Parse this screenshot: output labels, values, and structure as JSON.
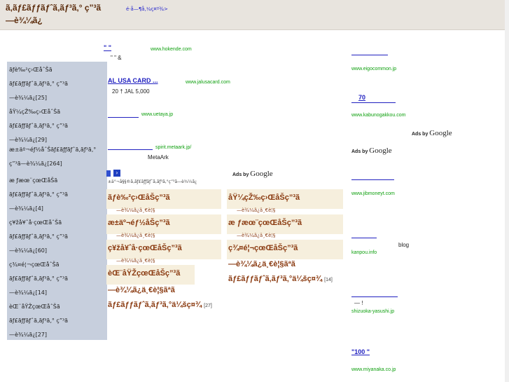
{
  "header": {
    "title_line1": "ã‚ãƒ£ãƒƒãƒˆã‚ãƒ³ã‚° ç”³ã",
    "title_line2": "—è¾¼ã¿",
    "tagline": "é·å—¶å‚¼ç¤º¾>"
  },
  "sidebar": {
    "items": [
      {
        "line1": "ãƒè‰²ç›ŒåˆŠã",
        "line2": "ãƒ£ãƒƒãƒˆã‚ãƒ³ã‚° ç”³ã",
        "line3": "—è¾¼ã¿[25]"
      },
      {
        "line1": "åŸ¼çŽ‰ç›ŒåˆŠã",
        "line2": "ãƒ£ãƒƒãƒˆã‚ãƒ³ã‚° ç”³ã",
        "line3": "—è¾¼ã¿[29]"
      },
      {
        "line1": "æ±äº¬éƒ½åˆŠãƒ£ãƒƒãƒˆã‚ãƒ³ã‚°",
        "line2": "ç”³ã—è¾¼ã¿[264]"
      },
      {
        "line1": "æ ƒæœ¨çœŒåŠã",
        "line2": "ãƒ£ãƒƒãƒˆã‚ãƒ³ã‚° ç”³ã",
        "line3": "—è¾¼ã¿[4]"
      },
      {
        "line1": "ç¥žå¥ˆå·çœŒåˆŠã",
        "line2": "ãƒ£ãƒƒãƒˆã‚ãƒ³ã‚° ç”³ã",
        "line3": "—è¾¼ã¿[60]"
      },
      {
        "line1": "ç¾¤é¦¬çœŒåˆŠã",
        "line2": "ãƒ£ãƒƒãƒˆã‚ãƒ³ã‚° ç”³ã",
        "line3": "—è¾¼ã¿[14]"
      },
      {
        "line1": "èŒ¨åŸŽçœŒåˆŠã",
        "line2": "ãƒ£ãƒƒãƒˆã‚ãƒ³ã‚° ç”³ã",
        "line3": "—è¾¼ã¿[27]"
      }
    ]
  },
  "ads_left": [
    {
      "title": "\"       \"",
      "url": "www.hokende.com",
      "text": "\"       \"  &"
    },
    {
      "title": "AL USA CARD",
      "title_suffix": "...",
      "url": "www.jalusacard.com",
      "text": "20      † JAL      5,000"
    },
    {
      "title": "",
      "url": "www.uetaya.jp",
      "text": ""
    },
    {
      "title": "",
      "url": "spirit.metaark.jp/",
      "text": "MetaArk"
    }
  ],
  "nav_breadcrumb": "±ä°¬å§§®ã‚ãƒ£ãƒƒãƒˆã‚ãƒ³ã‚°ç”³ã—è¾¼ã¿",
  "ads_by_google": {
    "prefix": "Ads by",
    "brand": "Google"
  },
  "boxes": [
    {
      "title": "ãƒè‰²ç›ŒåŠç”³ã",
      "sub": "—è¾¼ã¿ä¸€è¦§"
    },
    {
      "title": "åŸ¼çŽ‰ç›ŒåŠç”³ã",
      "sub": "—è¾¼ã¿ä¸€è¦§"
    },
    {
      "title": "æ±äº¬éƒ½åŠç”³ã",
      "sub": "—è¾¼ã¿ä¸€è¦§"
    },
    {
      "title": "æ ƒæœ¨çœŒåŠç”³ã",
      "sub": "—è¾¼ã¿ä¸€è¦§"
    },
    {
      "title": "ç¥žå¥ˆå·çœŒåŠç”³ã",
      "sub": "—è¾¼ã¿ä¸€è¦§"
    },
    {
      "title": "ç¾¤é¦¬çœŒåŠç”³ã",
      "sub": ""
    },
    {
      "title": "èŒ¨åŸŽçœŒåŠç”³ã",
      "sub": ""
    }
  ],
  "box_details": {
    "gunma_line1": "—è¾¼ã¿ä¸€è¦§ãªã",
    "gunma_line2": "ãƒ£ãƒƒãƒˆã‚ãƒ³ã‚°ä¼šç¤¾",
    "gunma_count": "[14]",
    "ibaraki_line1": "—è¾¼ã¿ä¸€è¦§ãªã",
    "ibaraki_line2": "ãƒ£ãƒƒãƒˆã‚ãƒ³ã‚°ä¼šç¤¾",
    "ibaraki_count": "[27]"
  },
  "ads_right": [
    {
      "title": "",
      "url": "www.eigocommon.jp"
    },
    {
      "title": "70",
      "url": "www.kabunogakkou.com"
    },
    {
      "title": "",
      "url": "www.jibmoneyt.com"
    },
    {
      "title": "",
      "text": "blog",
      "url": "kanpou.info"
    },
    {
      "title": "",
      "text": "—             !",
      "url": "shizuoka-yasushi.jp"
    },
    {
      "title": "\"100         \"",
      "url": "www.miyanaka.co.jp"
    }
  ]
}
